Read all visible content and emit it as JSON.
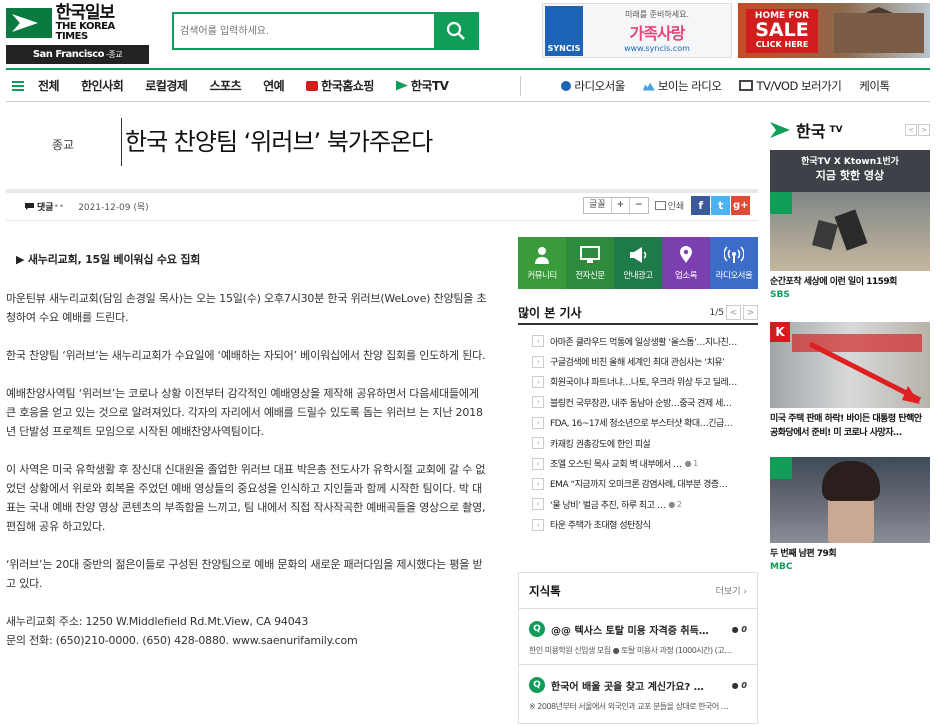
{
  "logo": {
    "korean": "한국일보",
    "english": "THE KOREA TIMES",
    "edition": "San Francisco",
    "edition_section": "-종교"
  },
  "search": {
    "placeholder": "검색어를 입력하세요."
  },
  "ads": {
    "syncis": {
      "brand": "SYNCIS",
      "tagline": "미래를 준비하세요.",
      "headline": "가족사랑",
      "url": "www.syncis.com"
    },
    "home_sale": {
      "line1": "HOME FOR",
      "line2": "SALE",
      "line3": "CLICK HERE"
    }
  },
  "nav": {
    "items": [
      "전체",
      "한인사회",
      "로컬경제",
      "스포츠",
      "연예",
      "한국홈쇼핑",
      "한국TV"
    ],
    "right_items": [
      "라디오서울",
      "보이는 라디오",
      "TV/VOD 보러가기",
      "케이톡"
    ]
  },
  "article": {
    "category": "종교",
    "title": "한국 찬양팀 ‘위러브’ 북가주온다",
    "comment_label": "댓글",
    "date": "2021-12-09 (목)",
    "subtitle": "▶ 새누리교회, 15일 베이워십 수요 집회",
    "paragraphs": [
      "마운틴뷰 새누리교회(담임 손경일 목사)는 오는 15일(수) 오후7시30분 한국 위러브(WeLove) 찬양팀을 초청하여 수요 예배를 드린다.",
      "한국 찬양팀 ‘위러브’는 새누리교회가 수요일에 ‘예배하는 자되어’ 베이워십에서 찬양 집회를 인도하게 된다.",
      "예배찬양사역팀 ‘위러브’는 코로나 상황 이전부터 감각적인 예배영상을 제작해 공유하면서 다음세대들에게 큰 호응을 얻고 있는 것으로 알려져있다. 각자의 자리에서 예배를 드릴수 있도록 돕는 위러브 는 지난 2018년 단발성 프로젝트 모임으로 시작된 예배찬양사역팀이다.",
      "이 사역은 미국 유학생활 후 장신대 신대원을 졸업한 위러브 대표 박은총 전도사가 유학시절 교회에 갈 수 없었던 상황에서 위로와 회복을 주었던 예배 영상들의 중요성을 인식하고 지인들과 함께 시작한 팀이다. 박 대표는 국내 예배 찬양 영상 콘텐츠의 부족함을 느끼고, 팀 내에서 직접 작사작곡한 예배곡들을 영상으로 촬영, 편집해 공유 하고있다.",
      "‘위러브’는 20대 중반의 젊은이들로 구성된 찬양팀으로 예배 문화의 새로운 패러다임을 제시했다는 평을 받고 있다."
    ],
    "address": "새누리교회 주소: 1250 W.Middlefield Rd.Mt.View, CA 94043",
    "phone": "문의 전화: (650)210-0000. (650) 428-0880. www.saenurifamily.com"
  },
  "tools": {
    "font_label": "글꼴",
    "plus": "+",
    "minus": "−",
    "print": "인쇄",
    "facebook": "f",
    "twitter": "t",
    "gplus": "g+"
  },
  "quick_links": [
    {
      "label": "커뮤니티",
      "icon": "person-icon",
      "color": "#3a9b3a"
    },
    {
      "label": "전자신문",
      "icon": "monitor-icon",
      "color": "#2e8b3e"
    },
    {
      "label": "안내광고",
      "icon": "megaphone-icon",
      "color": "#1f7a4a"
    },
    {
      "label": "업소록",
      "icon": "location-pin-icon",
      "color": "#7b3fb0"
    },
    {
      "label": "라디오서울",
      "icon": "radio-icon",
      "color": "#3b6cc8"
    }
  ],
  "popular": {
    "title": "많이 본 기사",
    "page": "1/5",
    "items": [
      {
        "text": "아마존 클라우드 먹통에 일상생활 ‘올스톱’…지나친…",
        "comments": ""
      },
      {
        "text": "구글검색에 비친 올해 세계인 최대 관심사는 ‘치유’",
        "comments": ""
      },
      {
        "text": "회원국이냐 파트너냐…나토, 우크라 위상 두고 딜레…",
        "comments": ""
      },
      {
        "text": "블링컨 국무장관, 내주 동남아 순방…중국 견제 세…",
        "comments": ""
      },
      {
        "text": "FDA, 16~17세 청소년으로 부스터샷 확대…긴급…",
        "comments": ""
      },
      {
        "text": "카재킹 권총강도에 한인 피살",
        "comments": ""
      },
      {
        "text": "조엘 오스틴 목사 교회 벽 내부에서 …",
        "comments": "1"
      },
      {
        "text": "EMA “지금까지 오미크론 감염사례, 대부분 경증…",
        "comments": ""
      },
      {
        "text": "‘물 낭비’ 벌금 추진, 하루 최고 …",
        "comments": "2"
      },
      {
        "text": "타운 주택가 초대형 성탄장식",
        "comments": ""
      }
    ]
  },
  "jisik": {
    "title": "지식톡",
    "more": "더보기",
    "items": [
      {
        "q": "@@ 텍사스 토탈 미용 자격증 취득…",
        "count": "0",
        "desc": "한인 미용학원 신입생 모집 ● 토탈 미용사 과정 (1000시간) (고…"
      },
      {
        "q": "한국어 배울 곳을 찾고 계신가요? …",
        "count": "0",
        "desc": "※ 2008년부터 서울에서 외국인과 교포 분들을 상대로 한국어 …"
      }
    ]
  },
  "korea_tv": {
    "logo": "한국",
    "logo_suffix": "TV",
    "videos": [
      {
        "caption": "순간포착 세상에 이런 일이 1159회",
        "source": "SBS",
        "overlay1": "한국TV X Ktown1번가",
        "overlay2": "지금 핫한 영상"
      },
      {
        "caption": "미국 주택 판매 하락! 바이든 대통령 탄핵안 공화당에서 준비! 미 코로나 사망자…",
        "source": "",
        "overlay1": "",
        "overlay2": ""
      },
      {
        "caption": "두 번째 남편 79회",
        "source": "MBC",
        "overlay1": "",
        "overlay2": ""
      }
    ]
  },
  "colors": {
    "brand_green": "#0f9d58",
    "accent_red": "#d11d1d"
  }
}
